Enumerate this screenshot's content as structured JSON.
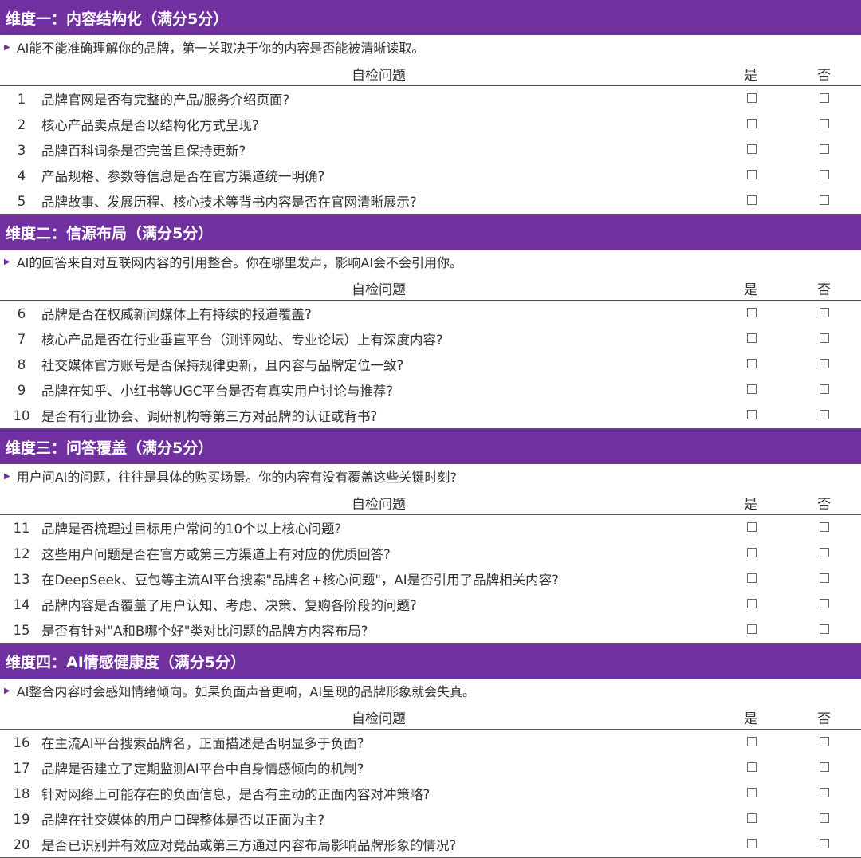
{
  "columns": {
    "question": "自检问题",
    "yes": "是",
    "no": "否"
  },
  "sections": [
    {
      "title": "维度一：内容结构化（满分5分）",
      "intro": "AI能不能准确理解你的品牌，第一关取决于你的内容是否能被清晰读取。",
      "rows": [
        {
          "num": "1",
          "text": "品牌官网是否有完整的产品/服务介绍页面?"
        },
        {
          "num": "2",
          "text": "核心产品卖点是否以结构化方式呈现?"
        },
        {
          "num": "3",
          "text": "品牌百科词条是否完善且保持更新?"
        },
        {
          "num": "4",
          "text": "产品规格、参数等信息是否在官方渠道统一明确?"
        },
        {
          "num": "5",
          "text": "品牌故事、发展历程、核心技术等背书内容是否在官网清晰展示?"
        }
      ]
    },
    {
      "title": "维度二：信源布局（满分5分）",
      "intro": "AI的回答来自对互联网内容的引用整合。你在哪里发声，影响AI会不会引用你。",
      "rows": [
        {
          "num": "6",
          "text": "品牌是否在权威新闻媒体上有持续的报道覆盖?"
        },
        {
          "num": "7",
          "text": "核心产品是否在行业垂直平台（测评网站、专业论坛）上有深度内容?"
        },
        {
          "num": "8",
          "text": "社交媒体官方账号是否保持规律更新，且内容与品牌定位一致?"
        },
        {
          "num": "9",
          "text": "品牌在知乎、小红书等UGC平台是否有真实用户讨论与推荐?"
        },
        {
          "num": "10",
          "text": "是否有行业协会、调研机构等第三方对品牌的认证或背书?"
        }
      ]
    },
    {
      "title": "维度三：问答覆盖（满分5分）",
      "intro": "用户问AI的问题，往往是具体的购买场景。你的内容有没有覆盖这些关键时刻?",
      "rows": [
        {
          "num": "11",
          "text": "品牌是否梳理过目标用户常问的10个以上核心问题?"
        },
        {
          "num": "12",
          "text": "这些用户问题是否在官方或第三方渠道上有对应的优质回答?"
        },
        {
          "num": "13",
          "text": "在DeepSeek、豆包等主流AI平台搜索\"品牌名+核心问题\"，AI是否引用了品牌相关内容?"
        },
        {
          "num": "14",
          "text": "品牌内容是否覆盖了用户认知、考虑、决策、复购各阶段的问题?"
        },
        {
          "num": "15",
          "text": "是否有针对\"A和B哪个好\"类对比问题的品牌方内容布局?"
        }
      ]
    },
    {
      "title": "维度四：AI情感健康度（满分5分）",
      "intro": "AI整合内容时会感知情绪倾向。如果负面声音更响，AI呈现的品牌形象就会失真。",
      "rows": [
        {
          "num": "16",
          "text": "在主流AI平台搜索品牌名，正面描述是否明显多于负面?"
        },
        {
          "num": "17",
          "text": "品牌是否建立了定期监测AI平台中自身情感倾向的机制?"
        },
        {
          "num": "18",
          "text": "针对网络上可能存在的负面信息，是否有主动的正面内容对冲策略?"
        },
        {
          "num": "19",
          "text": "品牌在社交媒体的用户口碑整体是否以正面为主?"
        },
        {
          "num": "20",
          "text": "是否已识别并有效应对竞品或第三方通过内容布局影响品牌形象的情况?"
        }
      ]
    }
  ]
}
